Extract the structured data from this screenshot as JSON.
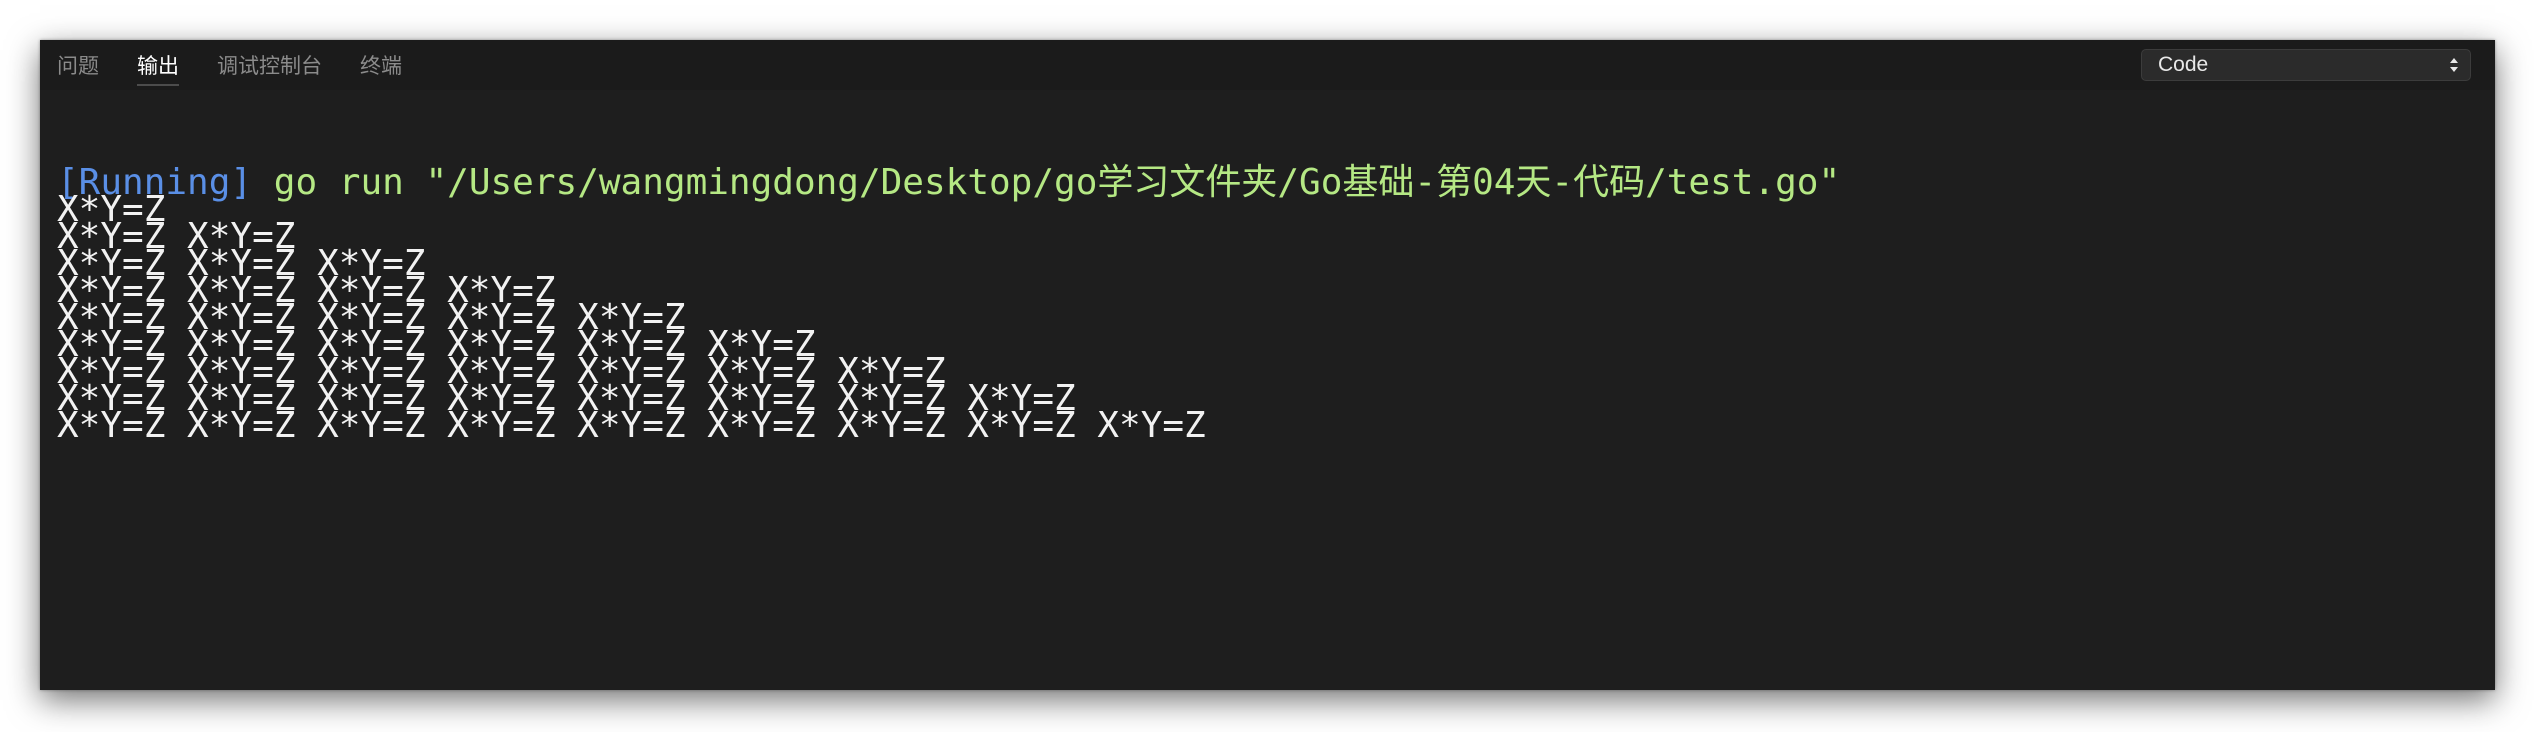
{
  "tabs": [
    {
      "label": "问题",
      "active": false
    },
    {
      "label": "输出",
      "active": true
    },
    {
      "label": "调试控制台",
      "active": false
    },
    {
      "label": "终端",
      "active": false
    }
  ],
  "output_channel_select": {
    "value": "Code"
  },
  "output": {
    "running_tag": "[Running]",
    "command": "go run \"/Users/wangmingdong/Desktop/go学习文件夹/Go基础-第04天-代码/test.go\"",
    "lines": [
      "X*Y=Z",
      "X*Y=Z X*Y=Z",
      "X*Y=Z X*Y=Z X*Y=Z",
      "X*Y=Z X*Y=Z X*Y=Z X*Y=Z",
      "X*Y=Z X*Y=Z X*Y=Z X*Y=Z X*Y=Z",
      "X*Y=Z X*Y=Z X*Y=Z X*Y=Z X*Y=Z X*Y=Z",
      "X*Y=Z X*Y=Z X*Y=Z X*Y=Z X*Y=Z X*Y=Z X*Y=Z",
      "X*Y=Z X*Y=Z X*Y=Z X*Y=Z X*Y=Z X*Y=Z X*Y=Z X*Y=Z",
      "X*Y=Z X*Y=Z X*Y=Z X*Y=Z X*Y=Z X*Y=Z X*Y=Z X*Y=Z X*Y=Z"
    ]
  },
  "colors": {
    "panel_background": "#1e1e1e",
    "header_background": "#1b1b1b",
    "running_tag": "#5a8fe6",
    "command": "#b5e884",
    "output_text": "#f2f2f2"
  },
  "icons": {
    "select_arrows": "chevron-up-down-icon"
  }
}
